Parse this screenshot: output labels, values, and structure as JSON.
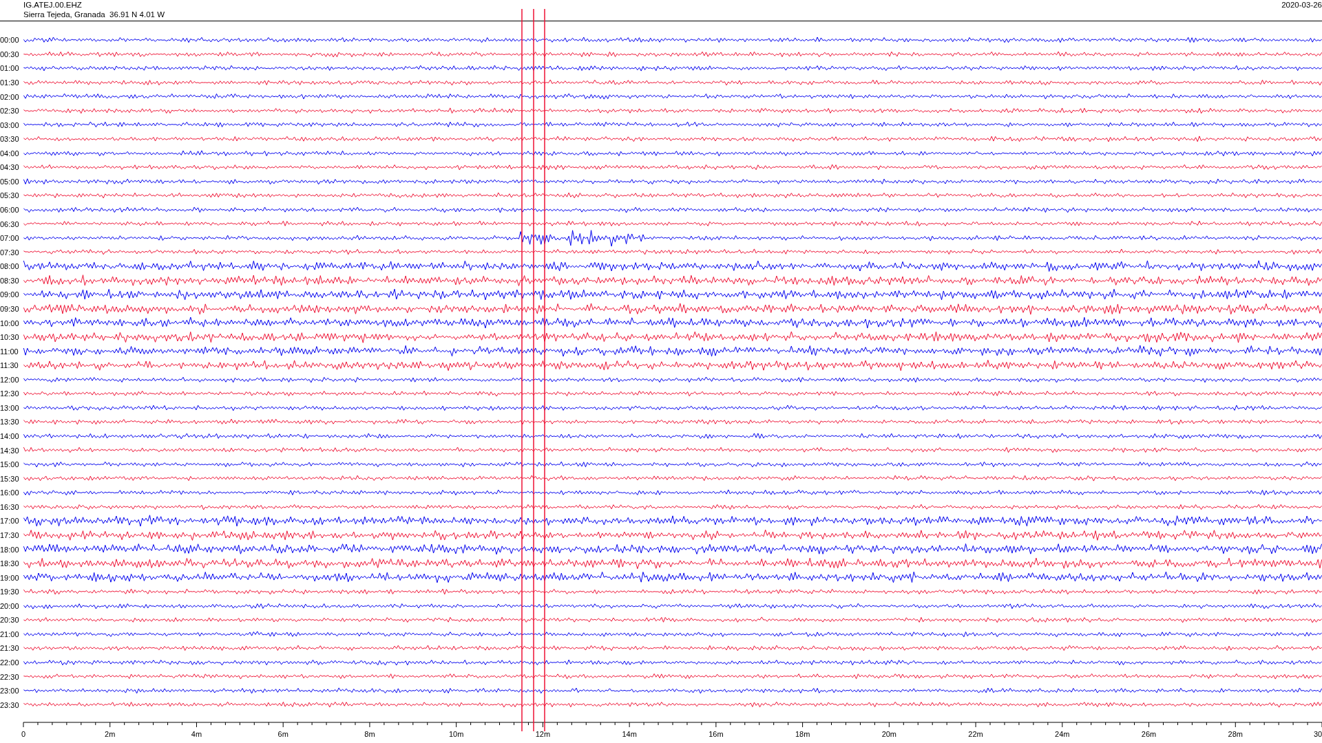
{
  "header": {
    "station": "IG.ATEJ.00.EHZ",
    "location": "Sierra Tejeda, Granada  36.91 N 4.01 W",
    "date": "2020-03-26"
  },
  "rows": [
    {
      "time": "00:00",
      "color": "#0000ee"
    },
    {
      "time": "00:30",
      "color": "#ee1133"
    },
    {
      "time": "01:00",
      "color": "#0000ee"
    },
    {
      "time": "01:30",
      "color": "#ee1133"
    },
    {
      "time": "02:00",
      "color": "#0000ee"
    },
    {
      "time": "02:30",
      "color": "#ee1133"
    },
    {
      "time": "03:00",
      "color": "#0000ee"
    },
    {
      "time": "03:30",
      "color": "#ee1133"
    },
    {
      "time": "04:00",
      "color": "#0000ee"
    },
    {
      "time": "04:30",
      "color": "#ee1133"
    },
    {
      "time": "05:00",
      "color": "#0000ee"
    },
    {
      "time": "05:30",
      "color": "#ee1133"
    },
    {
      "time": "06:00",
      "color": "#0000ee"
    },
    {
      "time": "06:30",
      "color": "#ee1133"
    },
    {
      "time": "07:00",
      "color": "#0000ee"
    },
    {
      "time": "07:30",
      "color": "#ee1133"
    },
    {
      "time": "08:00",
      "color": "#0000ee"
    },
    {
      "time": "08:30",
      "color": "#ee1133"
    },
    {
      "time": "09:00",
      "color": "#0000ee"
    },
    {
      "time": "09:30",
      "color": "#ee1133"
    },
    {
      "time": "10:00",
      "color": "#0000ee"
    },
    {
      "time": "10:30",
      "color": "#ee1133"
    },
    {
      "time": "11:00",
      "color": "#0000ee"
    },
    {
      "time": "11:30",
      "color": "#ee1133"
    },
    {
      "time": "12:00",
      "color": "#0000ee"
    },
    {
      "time": "12:30",
      "color": "#ee1133"
    },
    {
      "time": "13:00",
      "color": "#0000ee"
    },
    {
      "time": "13:30",
      "color": "#ee1133"
    },
    {
      "time": "14:00",
      "color": "#0000ee"
    },
    {
      "time": "14:30",
      "color": "#ee1133"
    },
    {
      "time": "15:00",
      "color": "#0000ee"
    },
    {
      "time": "15:30",
      "color": "#ee1133"
    },
    {
      "time": "16:00",
      "color": "#0000ee"
    },
    {
      "time": "16:30",
      "color": "#ee1133"
    },
    {
      "time": "17:00",
      "color": "#0000ee"
    },
    {
      "time": "17:30",
      "color": "#ee1133"
    },
    {
      "time": "18:00",
      "color": "#0000ee"
    },
    {
      "time": "18:30",
      "color": "#ee1133"
    },
    {
      "time": "19:00",
      "color": "#0000ee"
    },
    {
      "time": "19:30",
      "color": "#ee1133"
    },
    {
      "time": "20:00",
      "color": "#0000ee"
    },
    {
      "time": "20:30",
      "color": "#ee1133"
    },
    {
      "time": "21:00",
      "color": "#0000ee"
    },
    {
      "time": "21:30",
      "color": "#ee1133"
    },
    {
      "time": "22:00",
      "color": "#0000ee"
    },
    {
      "time": "22:30",
      "color": "#ee1133"
    },
    {
      "time": "23:00",
      "color": "#0000ee"
    },
    {
      "time": "23:30",
      "color": "#ee1133"
    }
  ],
  "axis": {
    "labels": [
      "0",
      "2m",
      "4m",
      "6m",
      "8m",
      "10m",
      "12m",
      "14m",
      "16m",
      "18m",
      "20m",
      "22m",
      "24m",
      "26m",
      "28m",
      "30"
    ]
  }
}
